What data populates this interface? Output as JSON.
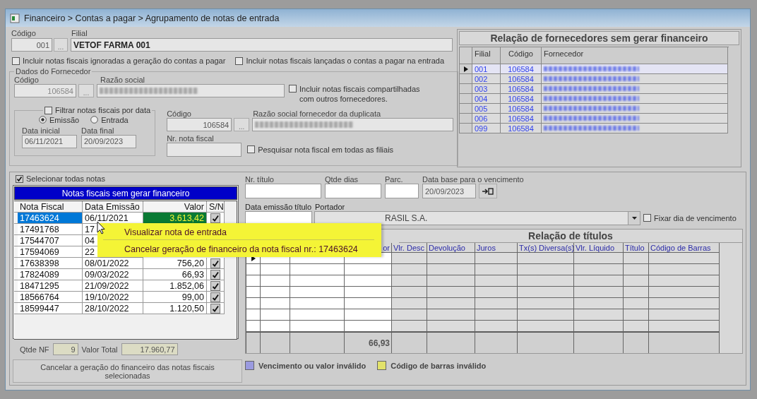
{
  "window": {
    "title": "Financeiro > Contas a pagar > Agrupamento de notas de entrada"
  },
  "branch": {
    "code_label": "Código",
    "code": "001",
    "button": "...",
    "name_label": "Filial",
    "name": "VETOF FARMA 001"
  },
  "options": [
    {
      "label": "Incluir notas fiscais ignoradas a geração do contas a pagar",
      "checked": false
    },
    {
      "label": "Incluir notas fiscais lançadas o contas a pagar na entrada",
      "checked": false
    }
  ],
  "supplier": {
    "legend": "Dados do Fornecedor",
    "code_label": "Código",
    "code": "106584",
    "button": "...",
    "name_label": "Razão social",
    "shared": {
      "label": "Incluir notas fiscais compartilhadas com outros fornecedores.",
      "checked": false
    }
  },
  "date_filter": {
    "label": "Filtrar notas fiscais por data",
    "checked": false,
    "radios": [
      {
        "label": "Emissão",
        "selected": true
      },
      {
        "label": "Entrada",
        "selected": false
      }
    ],
    "start_label": "Data inicial",
    "start": "06/11/2021",
    "end_label": "Data final",
    "end": "20/09/2023"
  },
  "duplicate": {
    "code_label": "Código",
    "code": "106584",
    "button": "...",
    "name_label": "Razão social fornecedor da duplicata"
  },
  "invoice_search": {
    "label": "Nr. nota fiscal",
    "all_branches": {
      "label": "Pesquisar nota fiscal em todas as filiais",
      "checked": false
    }
  },
  "suppliers_table": {
    "title": "Relação de fornecedores sem gerar financeiro",
    "columns": [
      "Filial",
      "Código",
      "Fornecedor"
    ],
    "rows": [
      {
        "branch": "001",
        "code": "106584",
        "selected": true
      },
      {
        "branch": "002",
        "code": "106584",
        "selected": false
      },
      {
        "branch": "003",
        "code": "106584",
        "selected": false
      },
      {
        "branch": "004",
        "code": "106584",
        "selected": false
      },
      {
        "branch": "005",
        "code": "106584",
        "selected": false
      },
      {
        "branch": "006",
        "code": "106584",
        "selected": false
      },
      {
        "branch": "099",
        "code": "106584",
        "selected": false
      }
    ]
  },
  "select_all": {
    "label": "Selecionar todas notas",
    "checked": true
  },
  "invoices": {
    "title": "Notas fiscais sem gerar financeiro",
    "columns": [
      "Nota Fiscal",
      "Data Emissão",
      "Valor",
      "S/N"
    ],
    "rows": [
      {
        "number": "17463624",
        "date": "06/11/2021",
        "value": "3.613,42",
        "checked": true,
        "selected": true
      },
      {
        "number": "17491768",
        "date": "17",
        "selected": false
      },
      {
        "number": "17544707",
        "date": "04",
        "selected": false
      },
      {
        "number": "17594069",
        "date": "22",
        "selected": false
      },
      {
        "number": "17638398",
        "date": "08/01/2022",
        "value": "756,20",
        "checked": true,
        "selected": false
      },
      {
        "number": "17824089",
        "date": "09/03/2022",
        "value": "66,93",
        "checked": true,
        "selected": false
      },
      {
        "number": "18471295",
        "date": "21/09/2022",
        "value": "1.852,06",
        "checked": true,
        "selected": false
      },
      {
        "number": "18566764",
        "date": "19/10/2022",
        "value": "99,00",
        "checked": true,
        "selected": false
      },
      {
        "number": "18599447",
        "date": "28/10/2022",
        "value": "1.120,50",
        "checked": true,
        "selected": false
      }
    ]
  },
  "summary": {
    "count_label": "Qtde NF",
    "count": "9",
    "total_label": "Valor Total",
    "total": "17.960,77"
  },
  "cancel_button": "Cancelar a geração do financeiro das notas fiscais selecionadas",
  "title_form": {
    "number_label": "Nr. título",
    "days_label": "Qtde dias",
    "parc_label": "Parc.",
    "base_label": "Data base para o vencimento",
    "base_date": "20/09/2023",
    "issue_label": "Data emissão título",
    "carrier_label": "Portador",
    "carrier": "RASIL S.A."
  },
  "fix_due_day": {
    "label": "Fixar dia de vencimento",
    "checked": false
  },
  "titles_table": {
    "title": "Relação de títulos",
    "columns": [
      "or",
      "Vlr. Desc",
      "Devolução",
      "Juros",
      "Tx(s) Diversa(s)",
      "Vlr. Líquido",
      "Título",
      "Código de Barras"
    ],
    "total": "66,93"
  },
  "legend": [
    {
      "label": "Vencimento ou valor inválido",
      "color": "#9a9ae0"
    },
    {
      "label": "Código de barras inválido",
      "color": "#e2e26a"
    }
  ],
  "context_menu": [
    {
      "label": "Visualizar nota de entrada"
    },
    {
      "label": "Cancelar geração de financeiro da nota fiscal nr.: 17463624"
    }
  ]
}
